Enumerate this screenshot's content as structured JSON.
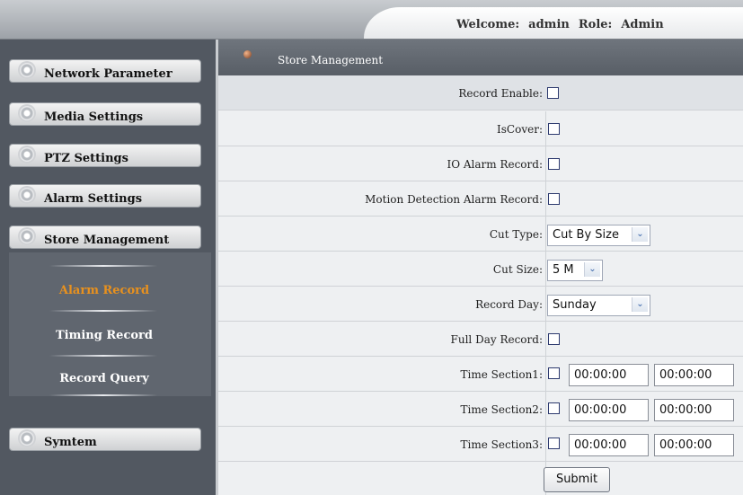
{
  "header": {
    "welcome_label": "Welcome:",
    "user": "admin",
    "role_label": "Role:",
    "role": "Admin"
  },
  "sidebar": {
    "items": [
      {
        "label": "Network Parameter"
      },
      {
        "label": "Media Settings"
      },
      {
        "label": "PTZ Settings"
      },
      {
        "label": "Alarm Settings"
      },
      {
        "label": "Store Management"
      },
      {
        "label": "Symtem"
      }
    ],
    "submenu": [
      {
        "label": "Alarm Record",
        "active": true
      },
      {
        "label": "Timing Record",
        "active": false
      },
      {
        "label": "Record Query",
        "active": false
      }
    ],
    "active_color": "#e8911e"
  },
  "content": {
    "title": "Store Management",
    "record_enable_label": "Record Enable:",
    "iscover_label": "IsCover:",
    "io_alarm_label": "IO Alarm Record:",
    "motion_label": "Motion Detection Alarm Record:",
    "cut_type_label": "Cut Type:",
    "cut_type_value": "Cut By Size",
    "cut_size_label": "Cut Size:",
    "cut_size_value": "5 M",
    "record_day_label": "Record Day:",
    "record_day_value": "Sunday",
    "full_day_label": "Full Day Record:",
    "sections": [
      {
        "label": "Time Section1:",
        "start": "00:00:00",
        "end": "00:00:00"
      },
      {
        "label": "Time Section2:",
        "start": "00:00:00",
        "end": "00:00:00"
      },
      {
        "label": "Time Section3:",
        "start": "00:00:00",
        "end": "00:00:00"
      }
    ],
    "submit_label": "Submit"
  },
  "icons": {
    "nav": "gear-icon",
    "content_header": "dot-icon",
    "select_arrow": "chevron-down-icon"
  }
}
